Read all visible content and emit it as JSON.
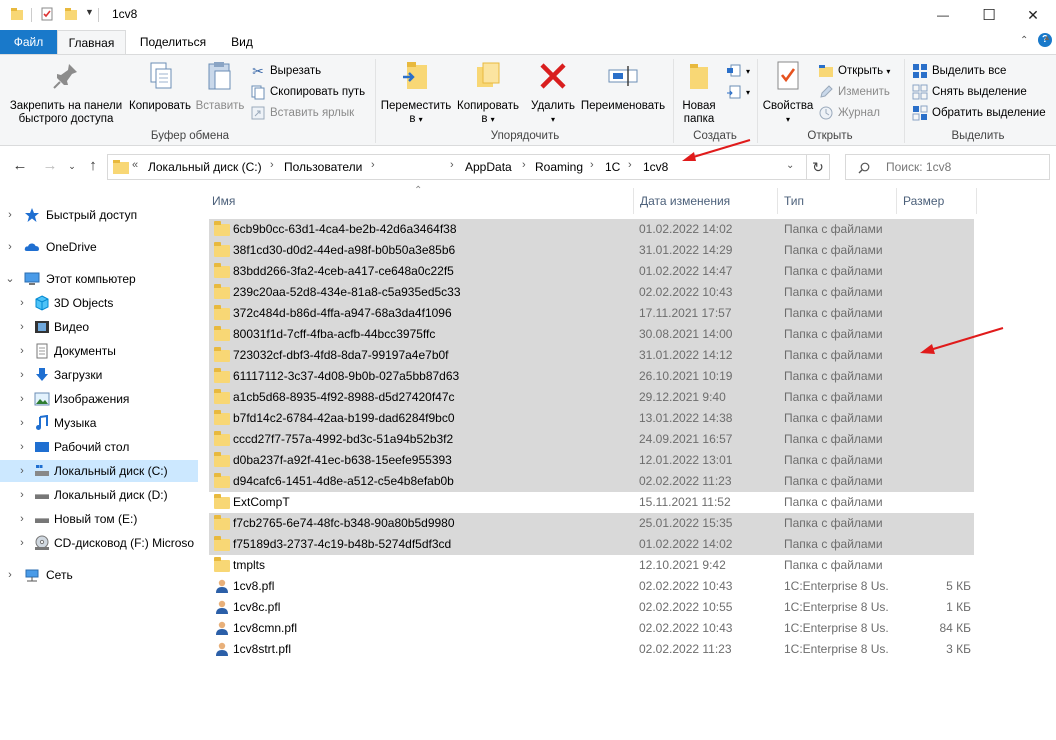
{
  "window": {
    "title": "1cv8",
    "minimize_glyph": "—",
    "maximize_glyph": "☐",
    "close_glyph": "✕"
  },
  "tabs": [
    {
      "label": "Файл"
    },
    {
      "label": "Главная"
    },
    {
      "label": "Поделиться"
    },
    {
      "label": "Вид"
    }
  ],
  "ribbon": {
    "clipboard": {
      "pin_label_1": "Закрепить на панели",
      "pin_label_2": "быстрого доступа",
      "copy_label": "Копировать",
      "paste_label": "Вставить",
      "cut_label": "Вырезать",
      "copy_path_label": "Скопировать путь",
      "paste_shortcut_label": "Вставить ярлык",
      "group_label": "Буфер обмена"
    },
    "organize": {
      "move_label_1": "Переместить",
      "move_label_2": "в",
      "copyto_label_1": "Копировать",
      "copyto_label_2": "в",
      "delete_label": "Удалить",
      "rename_label": "Переименовать",
      "group_label": "Упорядочить"
    },
    "new": {
      "new_folder_1": "Новая",
      "new_folder_2": "папка",
      "group_label": "Создать"
    },
    "open": {
      "properties_label": "Свойства",
      "open_label": "Открыть",
      "edit_label": "Изменить",
      "history_label": "Журнал",
      "group_label": "Открыть"
    },
    "select": {
      "select_all_label": "Выделить все",
      "select_none_label": "Снять выделение",
      "invert_label": "Обратить выделение",
      "group_label": "Выделить"
    }
  },
  "address": {
    "prefix": "«",
    "crumbs": [
      "Локальный диск (C:)",
      "Пользователи",
      "AppData",
      "Roaming",
      "1C",
      "1cv8"
    ],
    "search_placeholder": "Поиск: 1cv8"
  },
  "nav": [
    {
      "label": "Быстрый доступ",
      "icon": "star-icon"
    },
    {
      "label": "OneDrive",
      "icon": "cloud-icon"
    },
    {
      "label": "Этот компьютер",
      "icon": "computer-icon"
    },
    {
      "label": "3D Objects",
      "icon": "cube-icon"
    },
    {
      "label": "Видео",
      "icon": "film-icon"
    },
    {
      "label": "Документы",
      "icon": "document-icon"
    },
    {
      "label": "Загрузки",
      "icon": "download-icon"
    },
    {
      "label": "Изображения",
      "icon": "image-icon"
    },
    {
      "label": "Музыка",
      "icon": "music-icon"
    },
    {
      "label": "Рабочий стол",
      "icon": "desktop-icon"
    },
    {
      "label": "Локальный диск (C:)",
      "icon": "drive-icon"
    },
    {
      "label": "Локальный диск (D:)",
      "icon": "drive-icon"
    },
    {
      "label": "Новый том (E:)",
      "icon": "drive-icon"
    },
    {
      "label": "CD-дисковод (F:) Microso",
      "icon": "cd-icon"
    },
    {
      "label": "Сеть",
      "icon": "network-icon"
    }
  ],
  "columns": {
    "name": "Имя",
    "date": "Дата изменения",
    "type": "Тип",
    "size": "Размер"
  },
  "files": [
    {
      "name": "6cb9b0cc-63d1-4ca4-be2b-42d6a3464f38",
      "date": "01.02.2022 14:02",
      "type": "Папка с файлами",
      "size": ""
    },
    {
      "name": "38f1cd30-d0d2-44ed-a98f-b0b50a3e85b6",
      "date": "31.01.2022 14:29",
      "type": "Папка с файлами",
      "size": ""
    },
    {
      "name": "83bdd266-3fa2-4ceb-a417-ce648a0c22f5",
      "date": "01.02.2022 14:47",
      "type": "Папка с файлами",
      "size": ""
    },
    {
      "name": "239c20aa-52d8-434e-81a8-c5a935ed5c33",
      "date": "02.02.2022 10:43",
      "type": "Папка с файлами",
      "size": ""
    },
    {
      "name": "372c484d-b86d-4ffa-a947-68a3da4f1096",
      "date": "17.11.2021 17:57",
      "type": "Папка с файлами",
      "size": ""
    },
    {
      "name": "80031f1d-7cff-4fba-acfb-44bcc3975ffc",
      "date": "30.08.2021 14:00",
      "type": "Папка с файлами",
      "size": ""
    },
    {
      "name": "723032cf-dbf3-4fd8-8da7-99197a4e7b0f",
      "date": "31.01.2022 14:12",
      "type": "Папка с файлами",
      "size": ""
    },
    {
      "name": "61117112-3c37-4d08-9b0b-027a5bb87d63",
      "date": "26.10.2021 10:19",
      "type": "Папка с файлами",
      "size": ""
    },
    {
      "name": "a1cb5d68-8935-4f92-8988-d5d27420f47c",
      "date": "29.12.2021 9:40",
      "type": "Папка с файлами",
      "size": ""
    },
    {
      "name": "b7fd14c2-6784-42aa-b199-dad6284f9bc0",
      "date": "13.01.2022 14:38",
      "type": "Папка с файлами",
      "size": ""
    },
    {
      "name": "cccd27f7-757a-4992-bd3c-51a94b52b3f2",
      "date": "24.09.2021 16:57",
      "type": "Папка с файлами",
      "size": ""
    },
    {
      "name": "d0ba237f-a92f-41ec-b638-15eefe955393",
      "date": "12.01.2022 13:01",
      "type": "Папка с файлами",
      "size": ""
    },
    {
      "name": "d94cafc6-1451-4d8e-a512-c5e4b8efab0b",
      "date": "02.02.2022 11:23",
      "type": "Папка с файлами",
      "size": ""
    },
    {
      "name": "ExtCompT",
      "date": "15.11.2021 11:52",
      "type": "Папка с файлами",
      "size": ""
    },
    {
      "name": "f7cb2765-6e74-48fc-b348-90a80b5d9980",
      "date": "25.01.2022 15:35",
      "type": "Папка с файлами",
      "size": ""
    },
    {
      "name": "f75189d3-2737-4c19-b48b-5274df5df3cd",
      "date": "01.02.2022 14:02",
      "type": "Папка с файлами",
      "size": ""
    },
    {
      "name": "tmplts",
      "date": "12.10.2021 9:42",
      "type": "Папка с файлами",
      "size": ""
    },
    {
      "name": "1cv8.pfl",
      "date": "02.02.2022 10:43",
      "type": "1C:Enterprise 8 Us...",
      "size": "5 КБ"
    },
    {
      "name": "1cv8c.pfl",
      "date": "02.02.2022 10:55",
      "type": "1C:Enterprise 8 Us...",
      "size": "1 КБ"
    },
    {
      "name": "1cv8cmn.pfl",
      "date": "02.02.2022 10:43",
      "type": "1C:Enterprise 8 Us...",
      "size": "84 КБ"
    },
    {
      "name": "1cv8strt.pfl",
      "date": "02.02.2022 11:23",
      "type": "1C:Enterprise 8 Us...",
      "size": "3 КБ"
    }
  ],
  "colors": {
    "file_tab": "#1979ca",
    "selection": "#d9d9d9",
    "nav_selected": "#cce8ff",
    "annotation_arrow": "#e01b1b",
    "folder": "#f8d775"
  }
}
